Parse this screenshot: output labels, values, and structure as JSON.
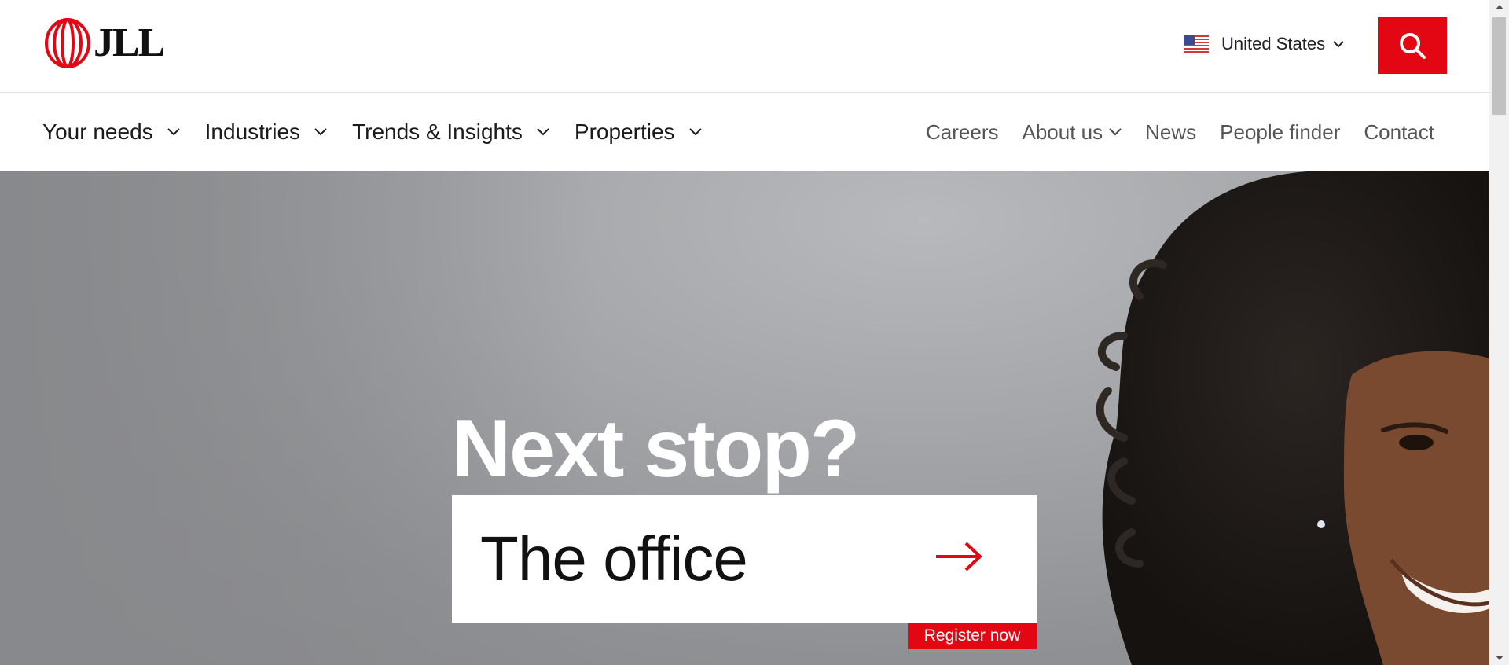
{
  "header": {
    "logo_text": "JLL",
    "country": "United States",
    "country_flag_icon": "us-flag-icon",
    "search_icon": "search-icon"
  },
  "nav": {
    "primary": [
      {
        "label": "Your needs"
      },
      {
        "label": "Industries"
      },
      {
        "label": "Trends & Insights"
      },
      {
        "label": "Properties"
      }
    ],
    "secondary": [
      {
        "label": "Careers"
      },
      {
        "label": "About us"
      },
      {
        "label": "News"
      },
      {
        "label": "People finder"
      },
      {
        "label": "Contact"
      }
    ]
  },
  "hero": {
    "headline": "Next stop?",
    "cta_text": "The office",
    "register_label": "Register now"
  },
  "colors": {
    "brand_red": "#e30613",
    "text_dark": "#1b1b1b",
    "text_muted": "#555555"
  }
}
